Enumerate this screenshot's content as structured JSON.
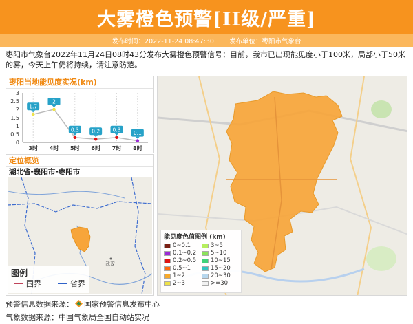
{
  "header": {
    "title": "大雾橙色预警[II级/严重]",
    "publish_label": "发布时间：",
    "publish_time": "2022-11-24 08:47:30",
    "unit_label": "发布单位：",
    "unit_name": "枣阳市气象台"
  },
  "description": "枣阳市气象台2022年11月24日08时43分发布大雾橙色预警信号：目前，我市已出现能见度小于100米，局部小于50米的雾，今天上午仍将持续，请注意防范。",
  "visibility_panel": {
    "title": "枣阳当地能见度实况(km)"
  },
  "location_panel": {
    "title": "定位概览",
    "region": "湖北省-襄阳市-枣阳市"
  },
  "mini_map": {
    "legend_title": "图例",
    "country_border": "国界",
    "province_border": "省界"
  },
  "visibility_legend": {
    "title": "能见度色值图例 (km)",
    "items": [
      {
        "label": "0~0.1",
        "color": "#7a1f14"
      },
      {
        "label": "3~5",
        "color": "#b6ef5e"
      },
      {
        "label": "0.1~0.2",
        "color": "#9b2bd6"
      },
      {
        "label": "5~10",
        "color": "#8ce25c"
      },
      {
        "label": "0.2~0.5",
        "color": "#e01515"
      },
      {
        "label": "10~15",
        "color": "#3fd27a"
      },
      {
        "label": "0.5~1",
        "color": "#ff6a10"
      },
      {
        "label": "15~20",
        "color": "#32c5c0"
      },
      {
        "label": "1~2",
        "color": "#f8a92b"
      },
      {
        "label": "20~30",
        "color": "#b7d7ee"
      },
      {
        "label": "2~3",
        "color": "#eee24a"
      },
      {
        "label": ">=30",
        "color": "#f2f2f2"
      }
    ]
  },
  "footer": {
    "source1_label": "预警信息数据来源：",
    "source1_name": "国家预警信息发布中心",
    "source2": "气象数据来源：中国气象局全国自动站实况"
  },
  "colors": {
    "accent": "#f7931e",
    "warning_area": "#f7a53a"
  },
  "chart_data": {
    "type": "line",
    "title": "枣阳当地能见度实况(km)",
    "categories": [
      "3时",
      "4时",
      "5时",
      "6时",
      "7时",
      "8时"
    ],
    "values": [
      1.7,
      2,
      0.3,
      0.2,
      0.3,
      0.1
    ],
    "value_labels": [
      "1.7",
      "2",
      "0.3",
      "0.2",
      "0.3",
      "0.1"
    ],
    "point_colors": [
      "#eee24a",
      "#eee24a",
      "#e01515",
      "#e01515",
      "#e01515",
      "#9b2bd6"
    ],
    "yticks": [
      0,
      0.5,
      1,
      1.5,
      2,
      2.5,
      3
    ],
    "ylim": [
      0,
      3
    ],
    "grid": false
  }
}
